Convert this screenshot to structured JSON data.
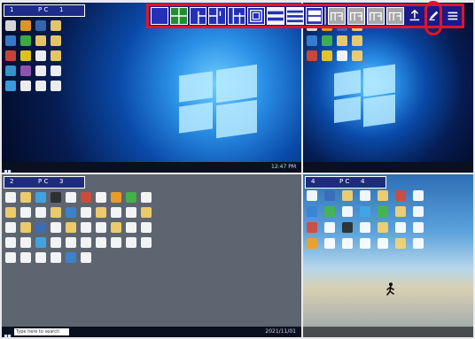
{
  "app": {
    "quadrants": [
      {
        "id": "top-left",
        "tab": {
          "left": "1",
          "pc": "P C",
          "right": "1"
        }
      },
      {
        "id": "top-right"
      },
      {
        "id": "bottom-left",
        "tab": {
          "left": "2",
          "pc": "P C",
          "right": "3"
        }
      },
      {
        "id": "bottom-right",
        "tab": {
          "left": "4",
          "pc": "P C",
          "right": "4"
        }
      }
    ],
    "taskbar": {
      "clock_tl": "12:47 PM",
      "clock_bl": "2021/11/01",
      "search_placeholder": "Type here to search"
    }
  },
  "toolbar": {
    "buttons": [
      "layout-single-icon",
      "layout-quad-icon",
      "layout-split-left-icon",
      "layout-split-right-icon",
      "layout-triple-icon",
      "layout-pip-icon",
      "layout-stack-2-icon",
      "layout-stack-3-icon",
      "layout-stack-4-icon",
      "display-a-icon",
      "display-b-icon",
      "display-c-icon",
      "display-d-icon",
      "upload-icon",
      "pen-icon",
      "menu-icon"
    ],
    "selected_index": 1
  },
  "colors": {
    "toolbar_border": "#e0142a",
    "toolbar_bg": "#1a1a88",
    "selected": "#1f8f2f"
  }
}
